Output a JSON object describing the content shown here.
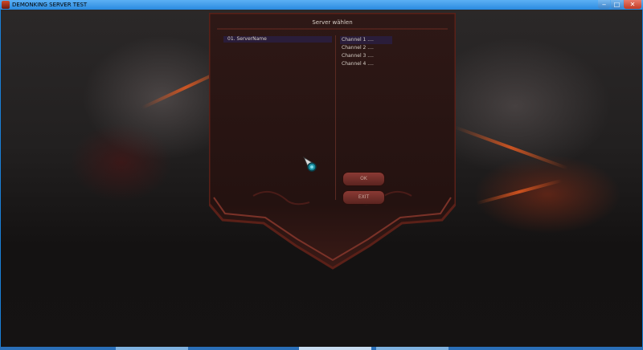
{
  "window": {
    "title": "DEMONKING SERVER TEST",
    "controls": {
      "minimize": "‒",
      "maximize": "□",
      "close": "✕"
    }
  },
  "dialog": {
    "title": "Server wählen",
    "servers": [
      {
        "label": "01. ServerName",
        "selected": true
      }
    ],
    "channels": [
      {
        "label": "Channel 1 ....",
        "selected": true
      },
      {
        "label": "Channel 2 ....",
        "selected": false
      },
      {
        "label": "Channel 3 ....",
        "selected": false
      },
      {
        "label": "Channel 4 ....",
        "selected": false
      }
    ],
    "ok_label": "OK",
    "exit_label": "EXIT"
  },
  "colors": {
    "titlebar": "#2a8ae0",
    "panel_fill": "#2a1614",
    "panel_border": "#6a2a22",
    "selection": "#2a1d3a",
    "button": "#7a302a"
  },
  "icons": {
    "app": "demonking-app-icon",
    "cursor": "game-cursor-icon"
  }
}
